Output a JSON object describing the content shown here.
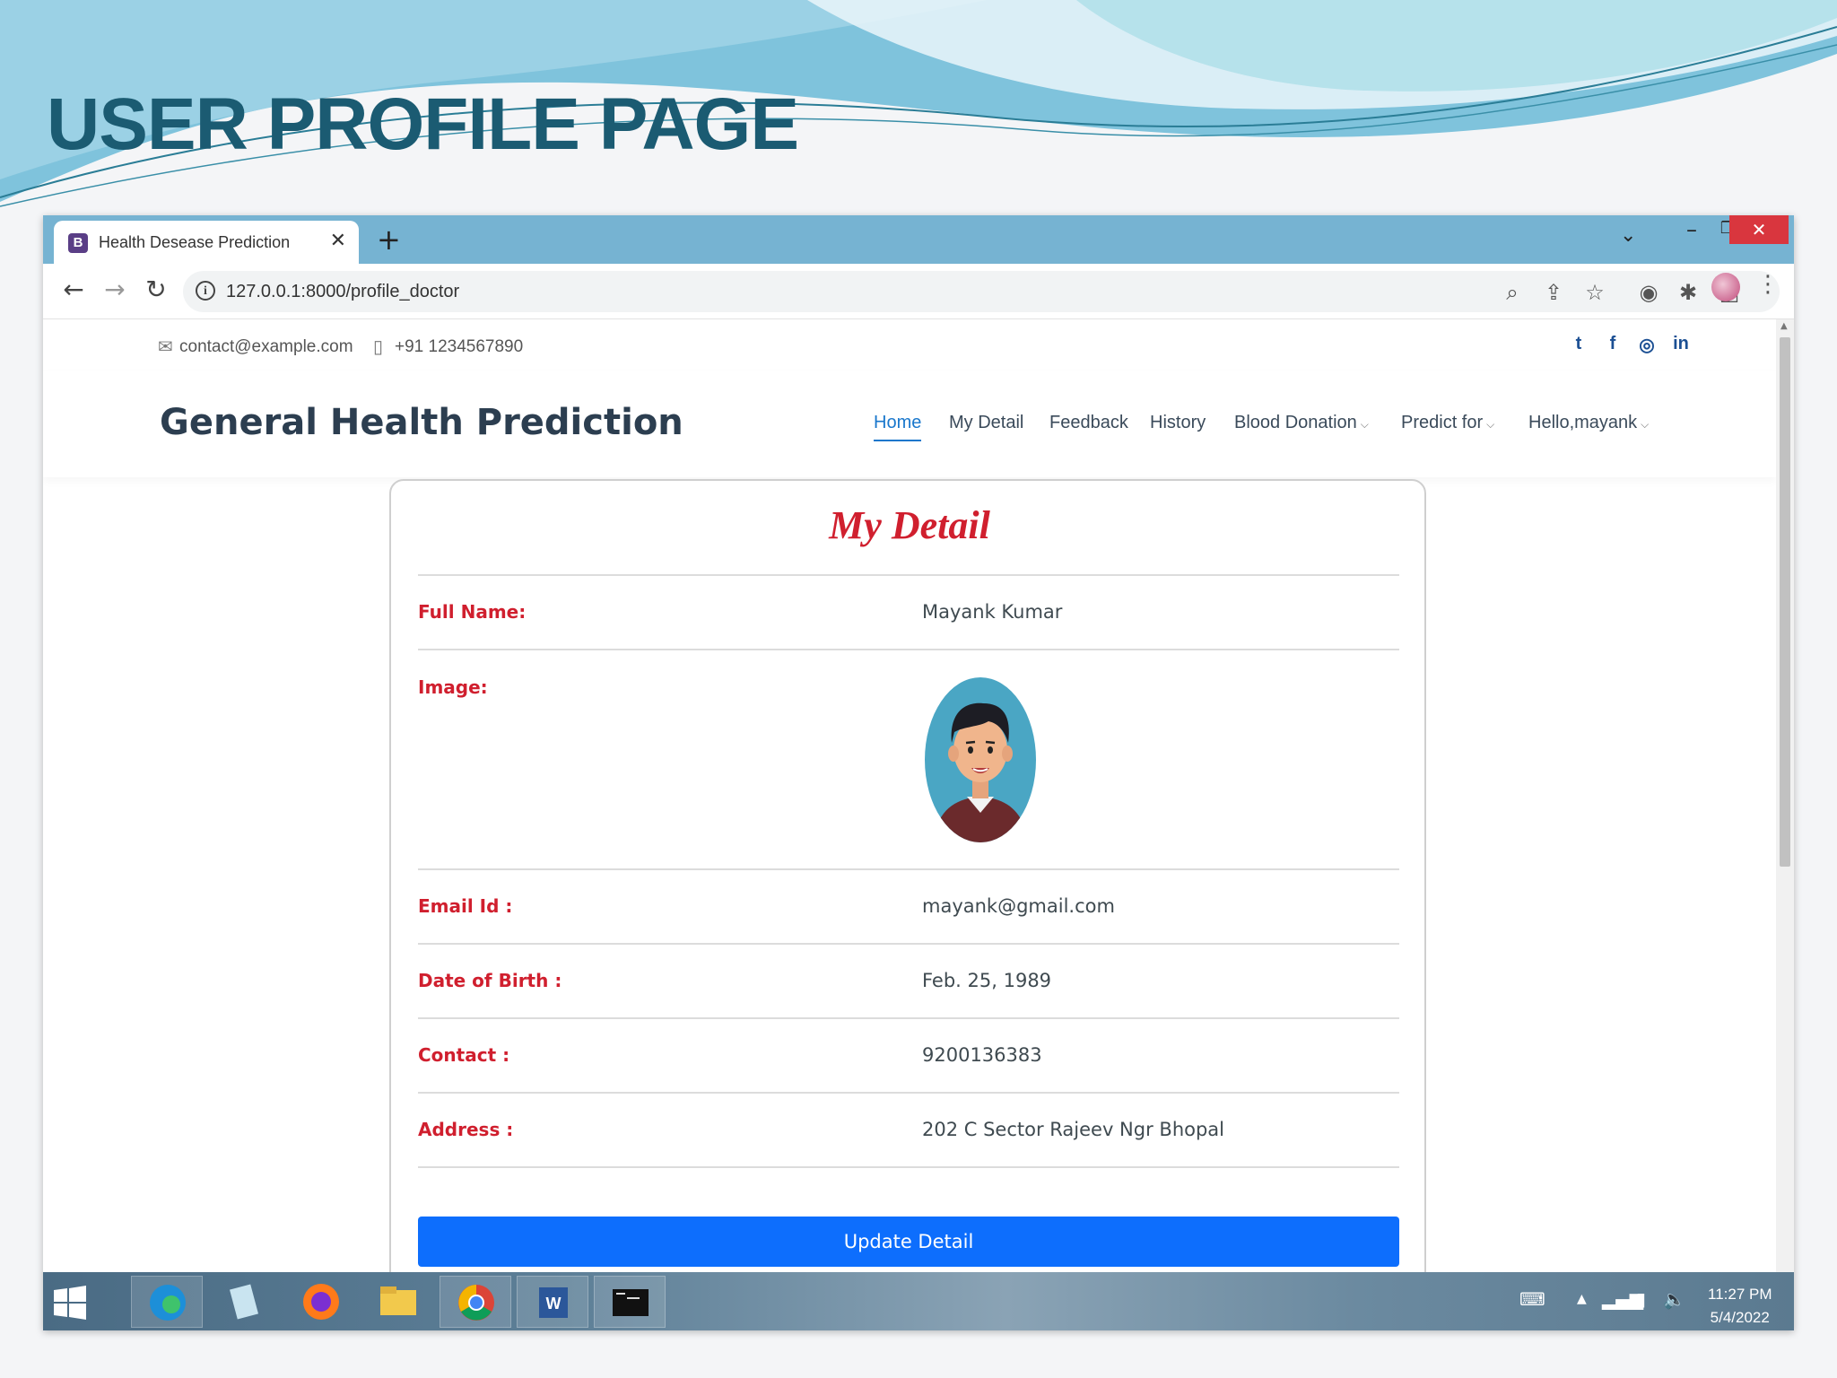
{
  "slide": {
    "title": "USER PROFILE PAGE"
  },
  "browser": {
    "tab_title": "Health Desease Prediction",
    "tab_favicon": "B",
    "tab_close": "✕",
    "new_tab": "+",
    "url": "127.0.0.1:8000/profile_doctor"
  },
  "site": {
    "topbar": {
      "email": "contact@example.com",
      "phone": "+91 1234567890"
    },
    "brand": "General Health Prediction",
    "nav": [
      {
        "label": "Home"
      },
      {
        "label": "My Detail"
      },
      {
        "label": "Feedback"
      },
      {
        "label": "History"
      },
      {
        "label": "Blood Donation"
      },
      {
        "label": "Predict for"
      },
      {
        "label": "Hello,mayank"
      }
    ]
  },
  "profile": {
    "title": "My Detail",
    "fields": [
      {
        "label": "Full Name:",
        "value": "Mayank Kumar"
      },
      {
        "label": "Image:",
        "value": ""
      },
      {
        "label": "Email Id :",
        "value": "mayank@gmail.com"
      },
      {
        "label": "Date of Birth :",
        "value": "Feb. 25, 1989"
      },
      {
        "label": "Contact :",
        "value": "9200136383"
      },
      {
        "label": "Address :",
        "value": "202 C Sector Rajeev Ngr Bhopal"
      }
    ],
    "update_button": "Update Detail"
  },
  "taskbar": {
    "time": "11:27 PM",
    "date": "5/4/2022"
  },
  "colors": {
    "accent": "#0d6efd",
    "label_red": "#d01f2e",
    "nav_active": "#1977cc",
    "title_teal": "#1b5b72"
  }
}
